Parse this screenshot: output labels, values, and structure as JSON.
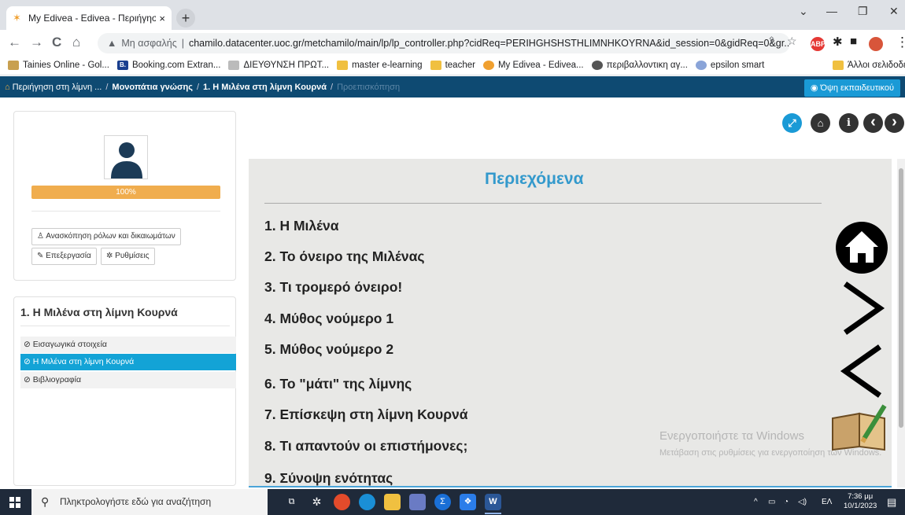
{
  "browser": {
    "tab_title": "My Edivea - Edivea - Περιήγηση",
    "tab_close": "×",
    "new_tab": "+",
    "address_warning": "Μη ασφαλής",
    "address_url": "chamilo.datacenter.uoc.gr/metchamilo/main/lp/lp_controller.php?cidReq=PERIHGHSHSTHLIMNHKOYRNA&id_session=0&gidReq=0&gr...",
    "window_controls": [
      "⌄",
      "—",
      "❐",
      "✕"
    ],
    "nav": [
      "←",
      "→",
      "C",
      "⌂"
    ],
    "extensions": [
      "ABP"
    ]
  },
  "bookmarks": [
    {
      "label": "Tainies Online - Gol...",
      "color": "#c8a050"
    },
    {
      "label": "Booking.com Extran...",
      "color": "#1a3f8f",
      "icon_text": "B."
    },
    {
      "label": "ΔΙΕΥΘΥΝΣΗ ΠΡΩΤ...",
      "color": "#bbbbbb"
    },
    {
      "label": "master e-learning",
      "color": "#f0c040"
    },
    {
      "label": "teacher",
      "color": "#f0c040"
    },
    {
      "label": "My Edivea - Edivea...",
      "color": "#f0a030"
    },
    {
      "label": "περιβαλλοντικη αγ...",
      "color": "#555555"
    },
    {
      "label": "epsilon smart",
      "color": "#8aa4d8"
    }
  ],
  "bookmarks_other": "Άλλοι σελιδοδείκτε",
  "breadcrumb": {
    "items": [
      "Περιήγηση στη λίμνη ...",
      "Μονοπάτια γνώσης",
      "1. Η Μιλένα στη λίμνη Κουρνά"
    ],
    "current": "Προεπισκόπηση",
    "separator": "/"
  },
  "teacher_view_button": "Όψη εκπαιδευτικού",
  "sidebar": {
    "progress_percent": 100,
    "progress_label": "100%",
    "roles_button": "Ανασκόπηση ρόλων και δικαιωμάτων",
    "edit_button": "Επεξεργασία",
    "settings_button": "Ρυθμίσεις",
    "lesson_title": "1. Η Μιλένα στη λίμνη Κουρνά",
    "items": [
      {
        "label": "Εισαγωγικά στοιχεία",
        "active": false
      },
      {
        "label": "Η Μιλένα στη λίμνη Κουρνά",
        "active": true
      },
      {
        "label": "Βιβλιογραφία",
        "active": false
      }
    ]
  },
  "toolbar": {
    "buttons": [
      {
        "name": "fullscreen",
        "glyph": "⤢",
        "color": "#1a9ad6"
      },
      {
        "name": "home",
        "glyph": "⌂",
        "color": "#333333"
      },
      {
        "name": "info",
        "glyph": "i",
        "color": "#333333"
      },
      {
        "name": "previous",
        "glyph": "‹",
        "color": "#333333"
      },
      {
        "name": "next",
        "glyph": "›",
        "color": "#333333"
      }
    ]
  },
  "content": {
    "heading": "Περιεχόμενα",
    "toc": [
      "1. Η Μιλένα",
      "2. Το όνειρο της Μιλένας",
      "3. Τι τρομερό όνειρο!",
      "4. Μύθος νούμερο 1",
      "5. Μύθος νούμερο 2",
      "6. Το \"μάτι\" της λίμνης",
      "7. Επίσκεψη στη λίμνη Κουρνά",
      "8. Τι απαντούν οι επιστήμονες;",
      "9. Σύνοψη ενότητας"
    ],
    "watermark_title": "Ενεργοποιήστε τα Windows",
    "watermark_text": "Μετάβαση στις ρυθμίσεις για ενεργοποίηση των Windows."
  },
  "taskbar": {
    "search_placeholder": "Πληκτρολογήστε εδώ για αναζήτηση",
    "language": "ΕΛ",
    "time": "7:36 μμ",
    "date": "10/1/2023"
  }
}
